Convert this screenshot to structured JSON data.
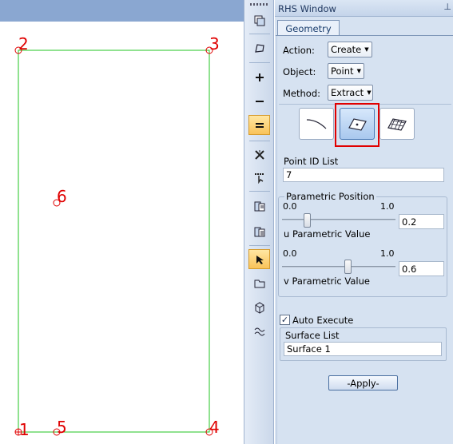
{
  "viewport": {
    "points": [
      {
        "id": "1",
        "label": "1"
      },
      {
        "id": "2",
        "label": "2"
      },
      {
        "id": "3",
        "label": "3"
      },
      {
        "id": "4",
        "label": "4"
      },
      {
        "id": "5",
        "label": "5"
      },
      {
        "id": "6",
        "label": "6"
      }
    ]
  },
  "toolbar": {
    "icons": [
      "copy-viewport-icon",
      "shape-icon",
      "zoom-in-icon",
      "zoom-out-icon",
      "fit-view-icon",
      "cross-icon",
      "pick-icon",
      "clipboard-icon",
      "paste-icon",
      "select-arrow-icon",
      "folder-icon",
      "cube-icon",
      "wave-icon"
    ],
    "active": [
      "fit-view-icon",
      "select-arrow-icon"
    ]
  },
  "rhs": {
    "title": "RHS Window",
    "pin_icon": "pin-icon",
    "tab": "Geometry",
    "action_label": "Action:",
    "action_value": "Create",
    "object_label": "Object:",
    "object_value": "Point",
    "method_label": "Method:",
    "method_value": "Extract",
    "shape_buttons": [
      "curve-icon",
      "surface-point-icon",
      "mesh-surface-icon"
    ],
    "selected_shape": "surface-point-icon",
    "point_id_label": "Point ID List",
    "point_id_value": "7",
    "parametric_group": "Parametric Position",
    "u_min": "0.0",
    "u_max": "1.0",
    "u_value": "0.2",
    "u_label": "u Parametric Value",
    "v_min": "0.0",
    "v_max": "1.0",
    "v_value": "0.6",
    "v_label": "v Parametric Value",
    "auto_execute_label": "Auto Execute",
    "auto_execute_checked": true,
    "surface_list_label": "Surface List",
    "surface_list_value": "Surface 1",
    "apply_label": "-Apply-"
  },
  "colors": {
    "geometry_line": "#22c422",
    "point_label": "#e00000",
    "highlight": "#e10000"
  }
}
